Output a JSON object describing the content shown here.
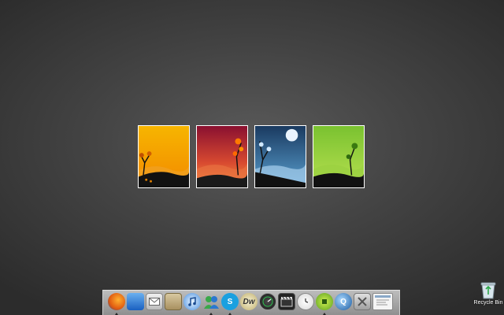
{
  "desktop": {
    "wallpaper_panels": [
      "autumn-panel",
      "sunset-panel",
      "winter-night-panel",
      "spring-panel"
    ]
  },
  "recycle_bin": {
    "label": "Recycle Bin",
    "icon": "recycle-bin-icon"
  },
  "dock": {
    "icons": [
      "firefox-icon",
      "finder-icon",
      "mail-icon",
      "notes-icon",
      "itunes-icon",
      "messenger-icon",
      "skype-icon",
      "dreamweaver-icon",
      "speedometer-icon",
      "video-clapper-icon",
      "clock-icon",
      "cpu-chip-icon",
      "quicktime-icon",
      "system-tools-icon",
      "document-window-icon"
    ],
    "running_indicators": [
      "firefox-icon",
      "messenger-icon",
      "skype-icon",
      "cpu-chip-icon"
    ]
  }
}
